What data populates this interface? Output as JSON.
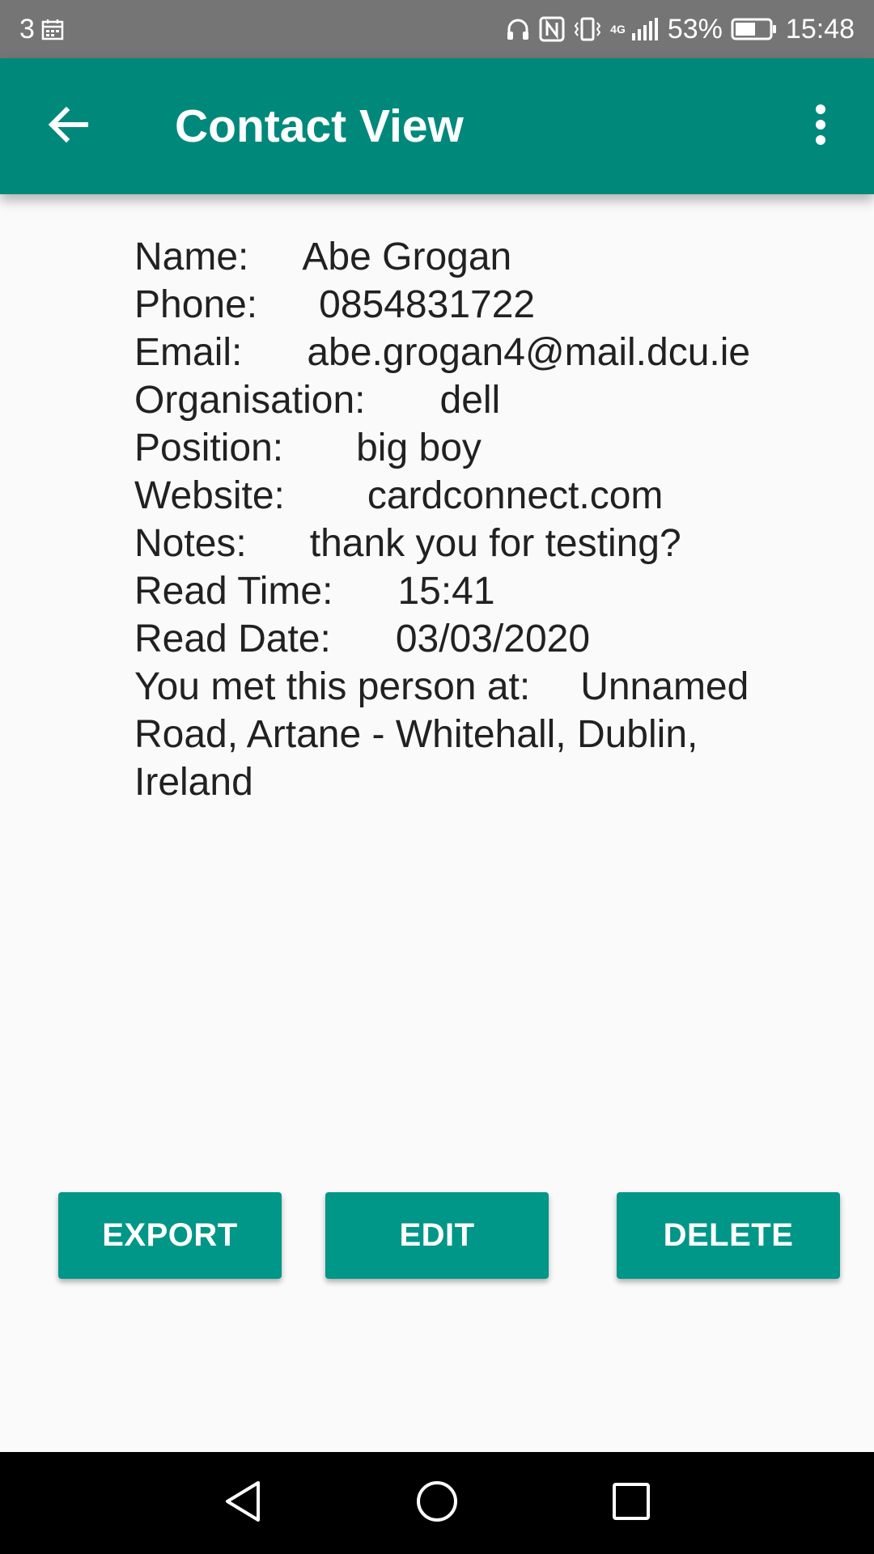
{
  "status_bar": {
    "notification_count": "3",
    "network_type": "4G",
    "battery_percent": "53%",
    "time": "15:48",
    "icons": [
      "calendar-icon",
      "headphones-icon",
      "nfc-icon",
      "vibrate-icon",
      "signal-icon",
      "battery-icon"
    ]
  },
  "toolbar": {
    "title": "Contact View",
    "back_icon": "arrow-back-icon",
    "menu_icon": "more-vert-icon"
  },
  "contact": {
    "name_label": "Name:",
    "name_value": "Abe Grogan",
    "phone_label": "Phone:",
    "phone_value": "0854831722",
    "email_label": "Email:",
    "email_value": "abe.grogan4@mail.dcu.ie",
    "organisation_label": "Organisation:",
    "organisation_value": "dell",
    "position_label": "Position:",
    "position_value": "big boy",
    "website_label": "Website:",
    "website_value": "cardconnect.com",
    "notes_label": "Notes:",
    "notes_value": "thank you for testing?",
    "read_time_label": "Read Time:",
    "read_time_value": "15:41",
    "read_date_label": "Read Date:",
    "read_date_value": "03/03/2020",
    "met_at_label": "You met this person at:",
    "met_at_value": "Unnamed Road, Artane - Whitehall, Dublin, Ireland"
  },
  "actions": {
    "export_label": "EXPORT",
    "edit_label": "EDIT",
    "delete_label": "DELETE"
  },
  "nav_bar": {
    "icons": [
      "nav-back-icon",
      "nav-home-icon",
      "nav-recents-icon"
    ]
  }
}
